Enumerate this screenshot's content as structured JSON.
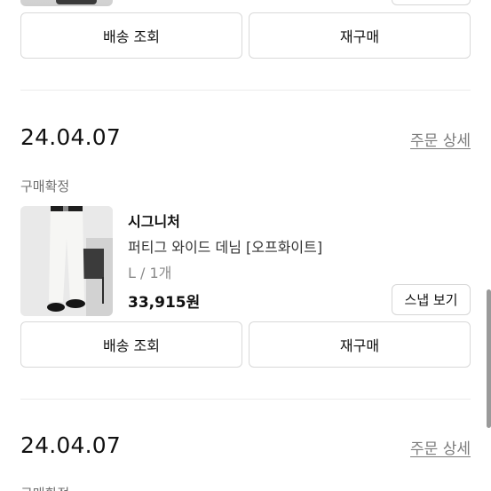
{
  "previous_order": {
    "shipping_button": "배송 조회",
    "rebuy_button": "재구매"
  },
  "order": {
    "date": "24.04.07",
    "detail_link": "주문 상세",
    "status": "구매확정",
    "item": {
      "brand": "시그니처",
      "name": "퍼티그 와이드 데님 [오프화이트]",
      "option": "L / 1개",
      "price": "33,915원",
      "snap_button": "스냅 보기"
    },
    "shipping_button": "배송 조회",
    "rebuy_button": "재구매"
  },
  "next_order": {
    "date": "24.04.07",
    "detail_link": "주문 상세",
    "status": "구매확정"
  }
}
